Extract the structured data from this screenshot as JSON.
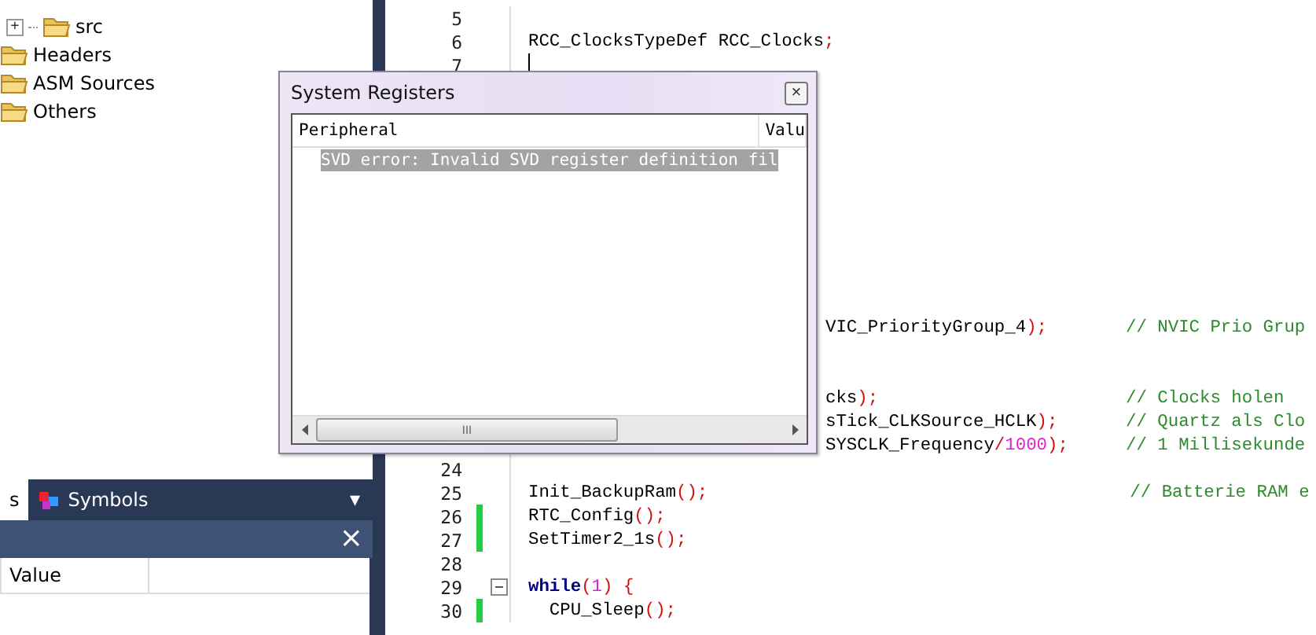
{
  "project_tree": {
    "items": [
      {
        "label": "src",
        "expander": "+"
      },
      {
        "label": "Headers"
      },
      {
        "label": "ASM Sources"
      },
      {
        "label": "Others"
      }
    ]
  },
  "bottom_panel": {
    "tabs": [
      {
        "label": "s",
        "selected": true,
        "icon": false
      },
      {
        "label": "Symbols",
        "selected": false,
        "icon": true
      }
    ],
    "menu_glyph": "▾",
    "close_glyph": "×",
    "columns": [
      "Value"
    ]
  },
  "editor": {
    "lines_top": [
      {
        "number": "5"
      },
      {
        "number": "6",
        "code": [
          {
            "text": "RCC_ClocksTypeDef RCC_Clocks",
            "kind": "plain"
          },
          {
            "text": ";",
            "kind": "punct"
          }
        ]
      },
      {
        "number": "7",
        "cursor": true
      }
    ],
    "lines_bottom": [
      {
        "clipped": true,
        "code": [
          {
            "text": "VIC_PriorityGroup_4",
            "kind": "plain"
          },
          {
            "text": ");",
            "kind": "punct"
          }
        ],
        "comment": "// NVIC Prio Grup"
      },
      {
        "clipped": true,
        "spaced": true,
        "code": [
          {
            "text": "cks",
            "kind": "plain"
          },
          {
            "text": ");",
            "kind": "punct"
          }
        ],
        "comment": "// Clocks holen"
      },
      {
        "clipped": true,
        "code": [
          {
            "text": "sTick_CLKSource_HCLK",
            "kind": "plain"
          },
          {
            "text": ");",
            "kind": "punct"
          }
        ],
        "comment": "// Quartz als Clo"
      },
      {
        "clipped": true,
        "code": [
          {
            "text": "SYSCLK_Frequency",
            "kind": "plain"
          },
          {
            "text": "/",
            "kind": "punct"
          },
          {
            "text": "1000",
            "kind": "number"
          },
          {
            "text": ");",
            "kind": "punct"
          }
        ],
        "comment": "// 1 Millisekunde"
      },
      {
        "number": "24"
      },
      {
        "number": "25",
        "code": [
          {
            "text": "Init_BackupRam",
            "kind": "plain"
          },
          {
            "text": "();",
            "kind": "punct"
          }
        ],
        "comment": "// Batterie RAM e"
      },
      {
        "number": "26",
        "changed": true,
        "code": [
          {
            "text": "RTC_Config",
            "kind": "plain"
          },
          {
            "text": "();",
            "kind": "punct"
          }
        ]
      },
      {
        "number": "27",
        "changed": true,
        "code": [
          {
            "text": "SetTimer2_1s",
            "kind": "plain"
          },
          {
            "text": "();",
            "kind": "punct"
          }
        ]
      },
      {
        "number": "28"
      },
      {
        "number": "29",
        "fold": true,
        "code": [
          {
            "text": "while",
            "kind": "keyword"
          },
          {
            "text": "(",
            "kind": "punct"
          },
          {
            "text": "1",
            "kind": "number"
          },
          {
            "text": ") {",
            "kind": "punct"
          }
        ]
      },
      {
        "number": "30",
        "changed": true,
        "code": [
          {
            "text": "  CPU_Sleep",
            "kind": "plain"
          },
          {
            "text": "();",
            "kind": "punct"
          }
        ]
      }
    ]
  },
  "dialog": {
    "title": "System Registers",
    "close_glyph": "×",
    "columns": [
      "Peripheral",
      "Valu"
    ],
    "rows": [
      {
        "text": "SVD error: Invalid SVD register definition fil",
        "selected": true
      }
    ],
    "scroll_grip": "III"
  }
}
